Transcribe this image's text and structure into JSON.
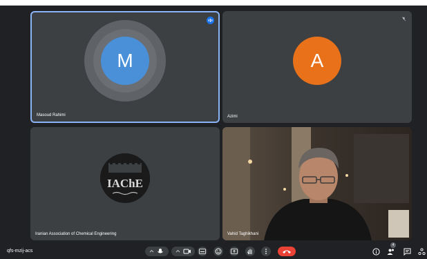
{
  "participants": [
    {
      "name": "Masoud Rahimi",
      "initial": "M",
      "color": "#4a90d9"
    },
    {
      "name": "Azimi",
      "initial": "A",
      "color": "#e8711a"
    },
    {
      "name": "Iranian Association of Chemical Engineering",
      "logo_text": "IAChE"
    },
    {
      "name": "Vahid Taghikhani"
    }
  ],
  "meeting": {
    "code": "qfs-mzij-acs"
  },
  "people_count": "4",
  "colors": {
    "accent": "#8ab4f8",
    "end_call": "#ea4335",
    "tile_bg": "#3c4043",
    "bg": "#202124"
  }
}
